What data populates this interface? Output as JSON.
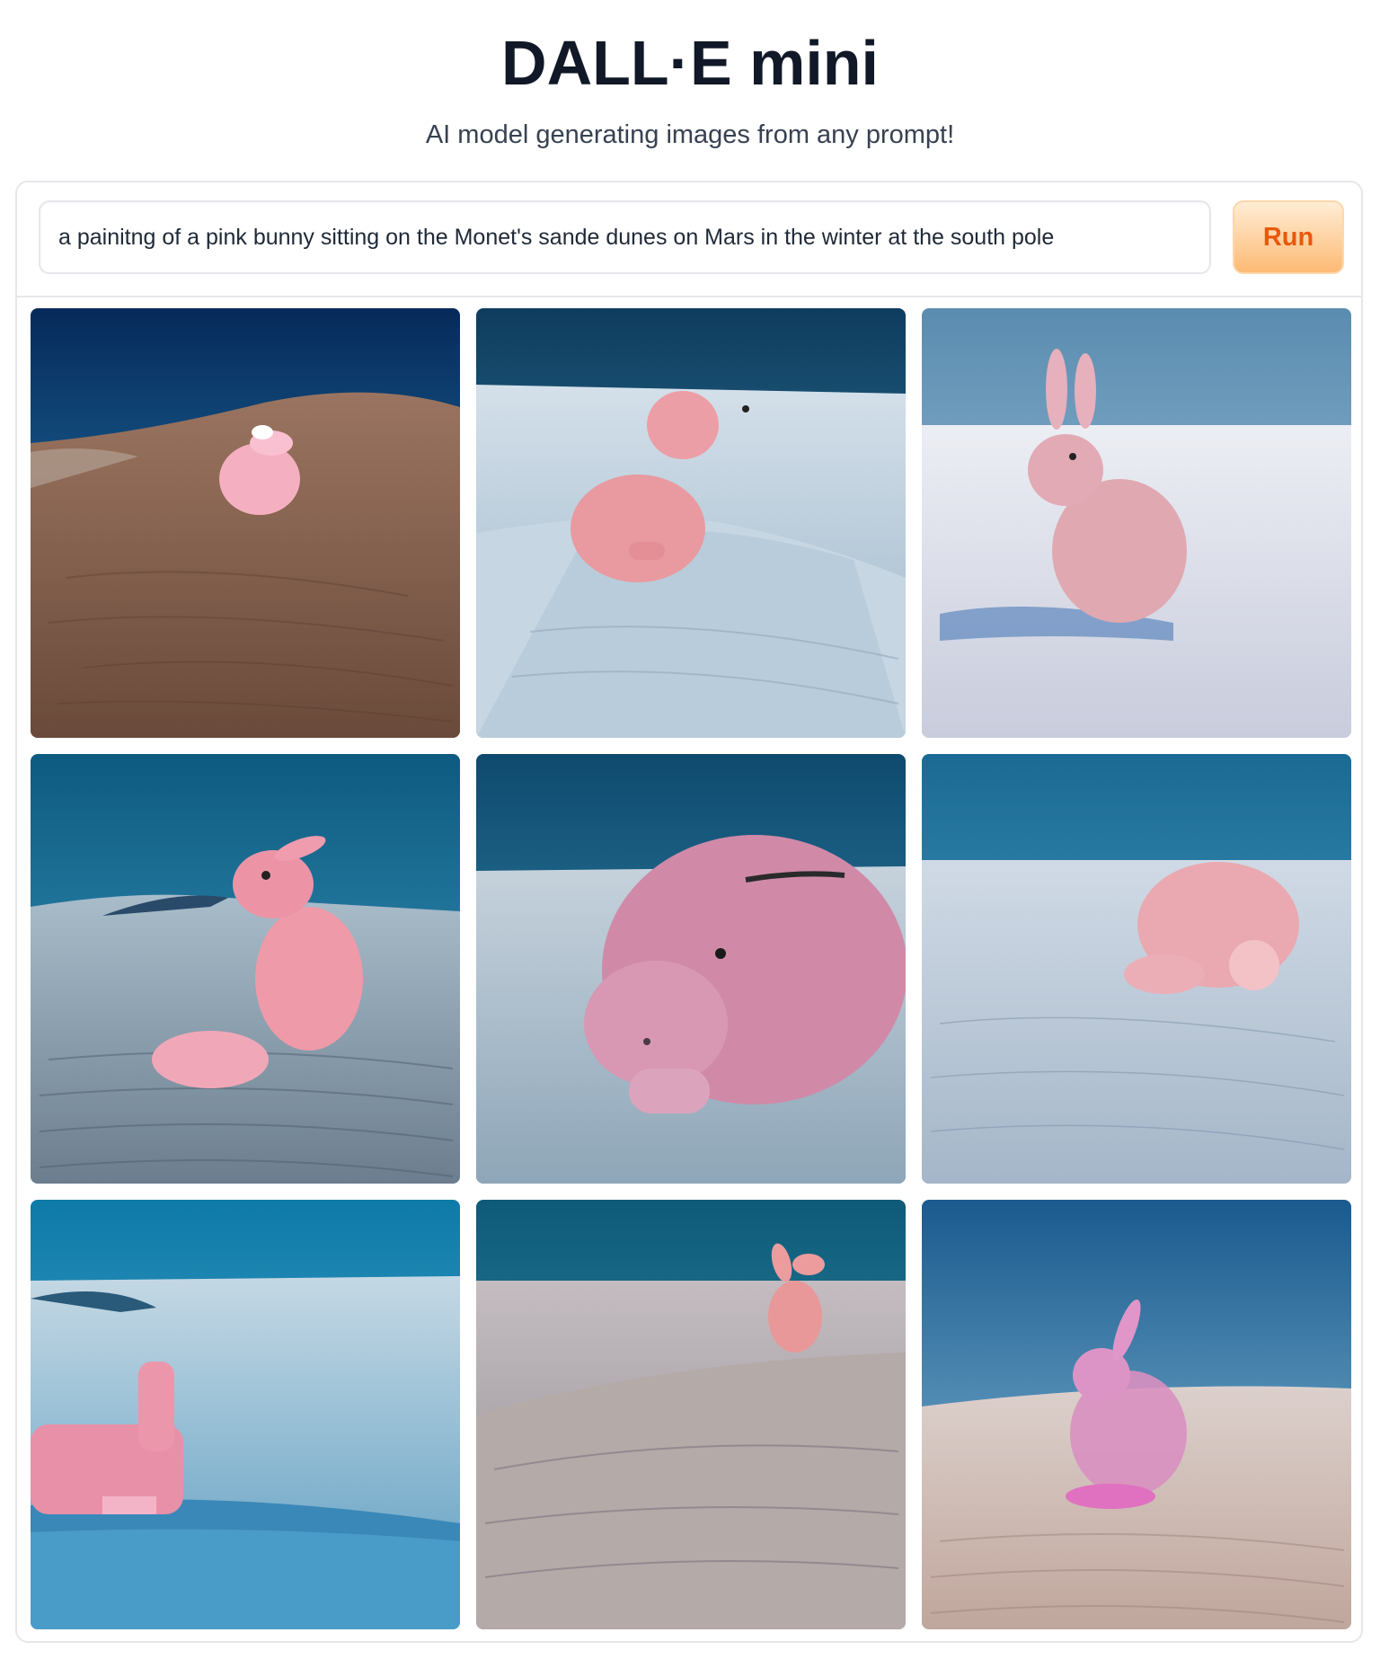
{
  "app": {
    "title": "DALL·E mini",
    "subtitle": "AI model generating images from any prompt!"
  },
  "prompt": {
    "value": "a painitng of a pink bunny sitting on the Monet's sande dunes on Mars in the winter at the south pole"
  },
  "run_button": {
    "label": "Run"
  },
  "colors": {
    "accent": "#ea580c",
    "button_top": "#ffedd5",
    "button_bottom": "#fdba74",
    "bunny_pink": "#e8a0a8",
    "sky_blue": "#1e6aa0"
  },
  "gallery": {
    "images": [
      {
        "name": "generated-image-1",
        "sky": [
          "#062a5a",
          "#2a8ec0"
        ],
        "ground": [
          "#8a6650",
          "#6a4a3a"
        ],
        "bunny": "#f0a8b8",
        "scene": "pink bunny on brown sand dune"
      },
      {
        "name": "generated-image-2",
        "sky": [
          "#0e3c5e",
          "#3d8fb0"
        ],
        "ground": [
          "#c8d8e4",
          "#9ab4c8"
        ],
        "bunny": "#e89aa0",
        "scene": "pink bunny on snowy ridge"
      },
      {
        "name": "generated-image-3",
        "sky": [
          "#5a8cb0",
          "#a8c8dc"
        ],
        "ground": [
          "#e4e4ee",
          "#c8ccdc"
        ],
        "bunny": "#e0a8b0",
        "scene": "pink rabbit sitting in snow"
      },
      {
        "name": "generated-image-4",
        "sky": [
          "#0e5a80",
          "#3fa0c4"
        ],
        "ground": [
          "#9cb0c0",
          "#6c7e8e"
        ],
        "bunny": "#ee9aa8",
        "scene": "pink rabbit on rippled dunes"
      },
      {
        "name": "generated-image-5",
        "sky": [
          "#0e4a6e",
          "#3c94b8"
        ],
        "ground": [
          "#bccad6",
          "#8ea6b8"
        ],
        "bunny": "#d08aa8",
        "scene": "giant pink bunny face close-up"
      },
      {
        "name": "generated-image-6",
        "sky": [
          "#1a6a94",
          "#54a8cc"
        ],
        "ground": [
          "#c8d4e0",
          "#a4b6c8"
        ],
        "bunny": "#eaa8b0",
        "scene": "pink bunny lying in snow"
      },
      {
        "name": "generated-image-7",
        "sky": [
          "#0e7aa8",
          "#5ab4d4"
        ],
        "ground": [
          "#a8c4d4",
          "#5a9cc0"
        ],
        "bunny": "#e890a8",
        "scene": "pink bunny shape on icy shore"
      },
      {
        "name": "generated-image-8",
        "sky": [
          "#0e5a78",
          "#3a9cbc"
        ],
        "ground": [
          "#b8b0b4",
          "#8e8c92"
        ],
        "bunny": "#e89898",
        "scene": "small pink bunny on dune crest"
      },
      {
        "name": "generated-image-9",
        "sky": [
          "#1a5a8e",
          "#8ec2dc"
        ],
        "ground": [
          "#d8c8c4",
          "#c0a69c"
        ],
        "bunny": "#d890c0",
        "scene": "translucent pink rabbit on sand"
      }
    ]
  }
}
